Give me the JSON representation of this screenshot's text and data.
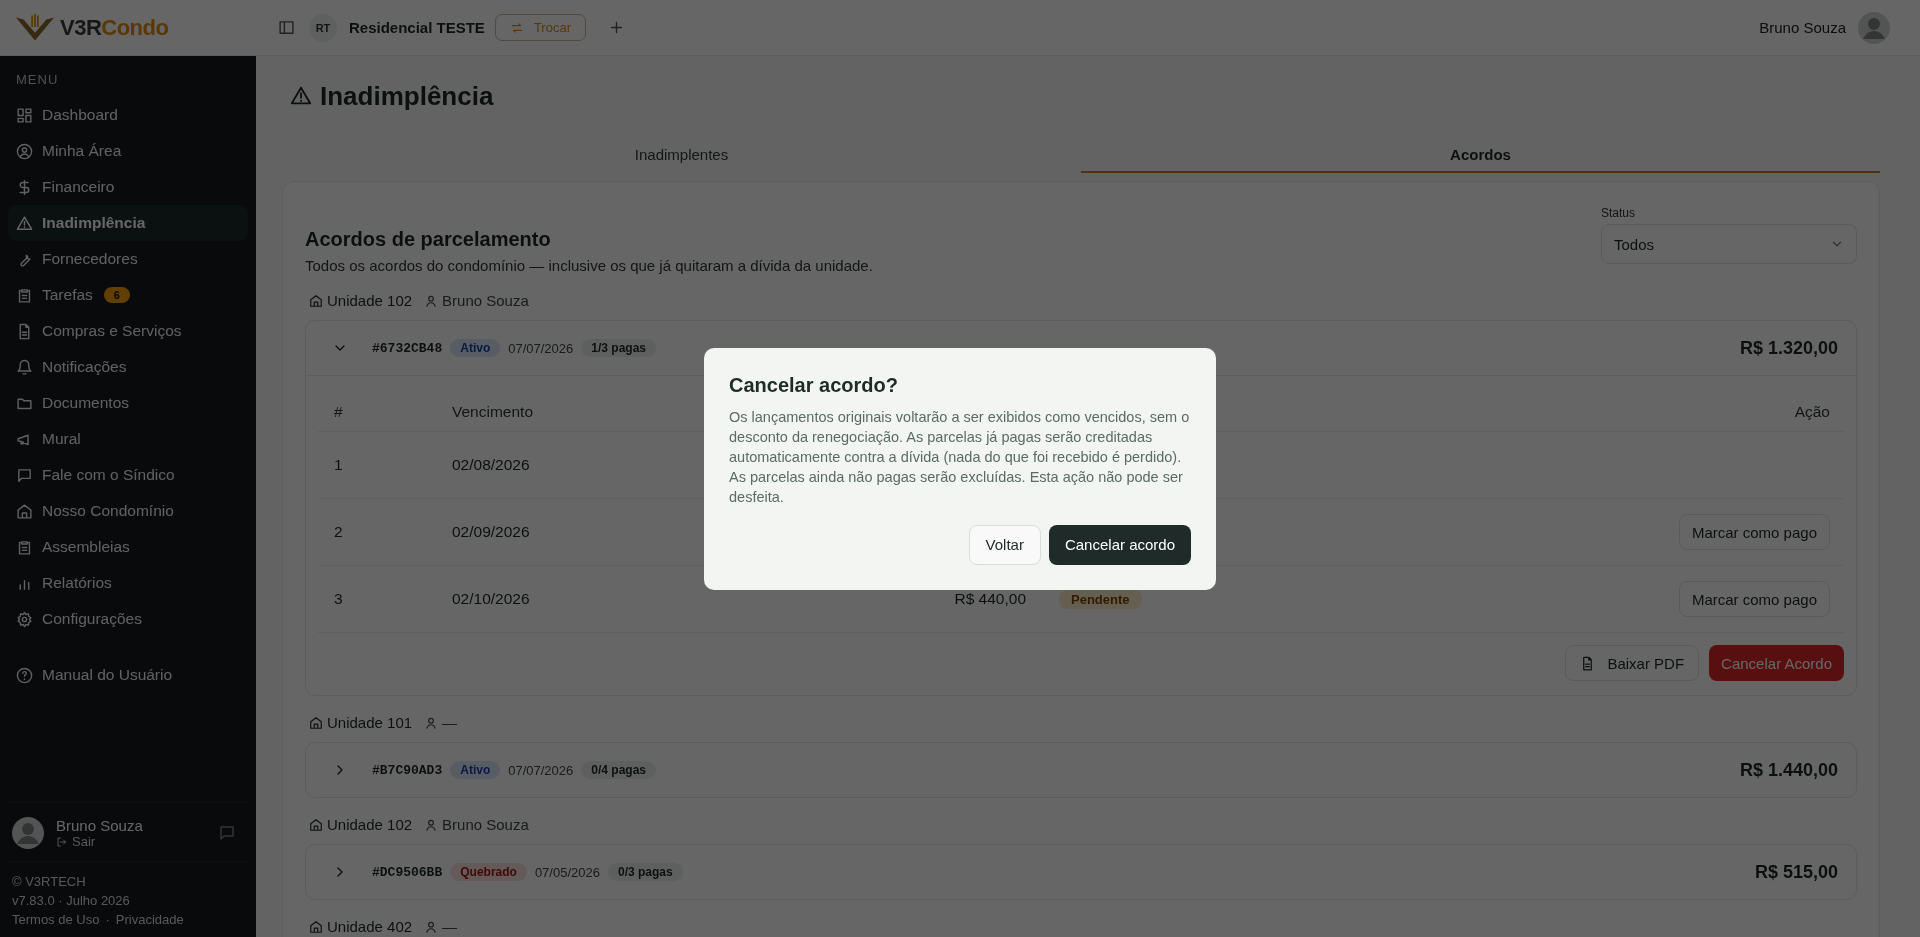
{
  "brand": {
    "prefix": "V3R",
    "suffix": "Condo"
  },
  "topbar": {
    "condo_initials": "RT",
    "condo_name": "Residencial TESTE",
    "switch_label": "Trocar",
    "user_name": "Bruno Souza"
  },
  "sidebar": {
    "section_label": "MENU",
    "items": [
      {
        "label": "Dashboard",
        "selected": false
      },
      {
        "label": "Minha Área",
        "selected": false
      },
      {
        "label": "Financeiro",
        "selected": false
      },
      {
        "label": "Inadimplência",
        "selected": true
      },
      {
        "label": "Fornecedores",
        "selected": false
      },
      {
        "label": "Tarefas",
        "selected": false,
        "badge": "6"
      },
      {
        "label": "Compras e Serviços",
        "selected": false
      },
      {
        "label": "Notificações",
        "selected": false
      },
      {
        "label": "Documentos",
        "selected": false
      },
      {
        "label": "Mural",
        "selected": false
      },
      {
        "label": "Fale com o Síndico",
        "selected": false
      },
      {
        "label": "Nosso Condomínio",
        "selected": false
      },
      {
        "label": "Assembleias",
        "selected": false
      },
      {
        "label": "Relatórios",
        "selected": false
      },
      {
        "label": "Configurações",
        "selected": false
      }
    ],
    "help_item": {
      "label": "Manual do Usuário"
    },
    "user": {
      "name": "Bruno Souza",
      "logout_label": "Sair"
    },
    "footer": {
      "copyright": "© V3RTECH",
      "version": "v7.83.0 · Julho 2026",
      "links": [
        "Termos de Uso",
        "Privacidade"
      ],
      "separator": "·"
    }
  },
  "page": {
    "title": "Inadimplência",
    "tabs": [
      {
        "label": "Inadimplentes",
        "selected": false
      },
      {
        "label": "Acordos",
        "selected": true
      }
    ],
    "card": {
      "title": "Acordos de parcelamento",
      "subtitle": "Todos os acordos do condomínio — inclusive os que já quitaram a dívida da unidade.",
      "filter": {
        "label": "Status",
        "value": "Todos"
      },
      "groups": [
        {
          "unit": "Unidade 102",
          "resident": "Bruno Souza",
          "agreement": {
            "code": "#6732CB48",
            "status": {
              "label": "Ativo",
              "kind": "active"
            },
            "date": "07/07/2026",
            "paid": "1/3 pagas",
            "total": "R$ 1.320,00",
            "expanded": true,
            "table": {
              "columns": [
                {
                  "label": "#",
                  "kind": "number"
                },
                {
                  "label": "Vencimento",
                  "kind": "due"
                },
                {
                  "label": "Ação",
                  "kind": "action"
                }
              ],
              "rows": [
                {
                  "number": "1",
                  "due": "02/08/2026"
                },
                {
                  "number": "2",
                  "due": "02/09/2026",
                  "action": "Marcar como pago"
                },
                {
                  "number": "3",
                  "due": "02/10/2026",
                  "amount": "R$ 440,00",
                  "status": "Pendente",
                  "action": "Marcar como pago"
                }
              ]
            },
            "buttons": [
              {
                "label": "Baixar PDF",
                "kind": "pdf"
              },
              {
                "label": "Cancelar Acordo",
                "kind": "danger"
              }
            ]
          }
        },
        {
          "unit": "Unidade 101",
          "resident": "—",
          "agreement": {
            "code": "#B7C90AD3",
            "status": {
              "label": "Ativo",
              "kind": "active"
            },
            "date": "07/07/2026",
            "paid": "0/4 pagas",
            "total": "R$ 1.440,00",
            "expanded": false
          }
        },
        {
          "unit": "Unidade 102",
          "resident": "Bruno Souza",
          "agreement": {
            "code": "#DC9506BB",
            "status": {
              "label": "Quebrado",
              "kind": "broken"
            },
            "date": "07/05/2026",
            "paid": "0/3 pagas",
            "total": "R$ 515,00",
            "expanded": false
          }
        },
        {
          "unit": "Unidade 402",
          "resident": "—"
        }
      ]
    }
  },
  "dialog": {
    "title": "Cancelar acordo?",
    "message": "Os lançamentos originais voltarão a ser exibidos como vencidos, sem o desconto da renegociação. As parcelas já pagas serão creditadas automaticamente contra a dívida (nada do que foi recebido é perdido). As parcelas ainda não pagas serão excluídas. Esta ação não pode ser desfeita.",
    "buttons": [
      {
        "label": "Voltar",
        "kind": "secondary"
      },
      {
        "label": "Cancelar acordo",
        "kind": "primary"
      }
    ]
  }
}
